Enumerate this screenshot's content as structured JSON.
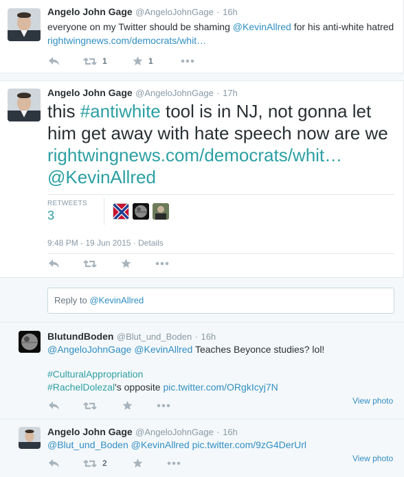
{
  "tweet1": {
    "name": "Angelo John Gage",
    "handle": "@AngeloJohnGage",
    "dot": "·",
    "time": "16h",
    "text_pre": "everyone on my Twitter should be shaming ",
    "mention": "@KevinAllred",
    "text_mid": " for his anti-white hatred ",
    "url": "rightwingnews.com/democrats/whit…",
    "retweet_count": "1",
    "favorite_count": "1"
  },
  "tweet2": {
    "name": "Angelo John Gage",
    "handle": "@AngeloJohnGage",
    "dot": "·",
    "time": "17h",
    "text_pre": "this ",
    "hashtag": "#antiwhite",
    "text_mid": " tool is in NJ, not gonna let him get away with hate speech now are we ",
    "url": "rightwingnews.com/democrats/whit…",
    "mention": "@KevinAllred",
    "retweets_label": "RETWEETS",
    "retweets_value": "3",
    "timestamp": "9:48 PM - 19 Jun 2015",
    "meta_sep": "·",
    "details": "Details"
  },
  "reply_box": {
    "prefix": "Reply to ",
    "mention": "@KevinAllred"
  },
  "reply1": {
    "name": "BlutundBoden",
    "handle": "@Blut_und_Boden",
    "dot": "·",
    "time": "16h",
    "mention1": "@AngeloJohnGage",
    "mention2": "@KevinAllred",
    "text1": " Teaches Beyonce studies? lol!",
    "hashtag1": "#CulturalAppropriation",
    "hashtag2": "#RachelDolezal",
    "text2": "'s opposite ",
    "pic": "pic.twitter.com/ORgkIcyj7N",
    "view_photo": "View photo"
  },
  "reply2": {
    "name": "Angelo John Gage",
    "handle": "@AngeloJohnGage",
    "dot": "·",
    "time": "16h",
    "mention1": "@Blut_und_Boden",
    "mention2": "@KevinAllred",
    "pic": "pic.twitter.com/9zG4DerUrl",
    "retweet_count": "2",
    "view_photo": "View photo"
  },
  "icons": {
    "reply": "reply-icon",
    "retweet": "retweet-icon",
    "favorite": "star-icon",
    "more": "more-icon"
  },
  "colors": {
    "link": "#2f8ec3",
    "hashtag": "#2b9fa3",
    "icon_gray": "#a8b4bd",
    "muted": "#8899a6"
  }
}
